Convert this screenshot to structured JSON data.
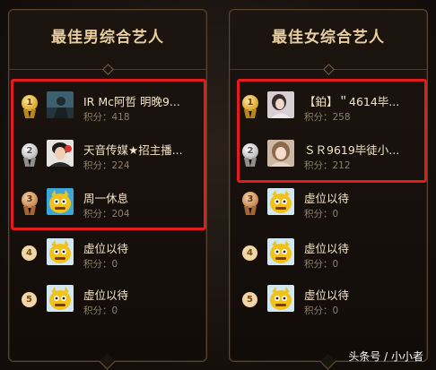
{
  "left_panel": {
    "title": "最佳男综合艺人",
    "entries": [
      {
        "rank": "1",
        "name": "IR Mc阿哲 明晚9...",
        "score": "积分：418"
      },
      {
        "rank": "2",
        "name": "天音传媒★招主播...",
        "score": "积分：224"
      },
      {
        "rank": "3",
        "name": "周一休息",
        "score": "积分：204"
      },
      {
        "rank": "4",
        "name": "虚位以待",
        "score": "积分：0"
      },
      {
        "rank": "5",
        "name": "虚位以待",
        "score": "积分：0"
      }
    ]
  },
  "right_panel": {
    "title": "最佳女综合艺人",
    "entries": [
      {
        "rank": "1",
        "name": "【鉑】＂4614毕...",
        "score": "积分：258"
      },
      {
        "rank": "2",
        "name": "ＳＲ9619毕徒小...",
        "score": "积分：212"
      },
      {
        "rank": "3",
        "name": "虚位以待",
        "score": "积分：0"
      },
      {
        "rank": "4",
        "name": "虚位以待",
        "score": "积分：0"
      },
      {
        "rank": "5",
        "name": "虚位以待",
        "score": "积分：0"
      }
    ]
  },
  "watermark": "头条号 / 小小者",
  "colors": {
    "background": "#1a1410",
    "title": "#e9cfa0",
    "name": "#f4e6c9",
    "score": "#8d7f6c",
    "highlight": "#e21b1b",
    "gold_medal": "#d9a227",
    "silver_medal": "#b9b9b9",
    "bronze_medal": "#c88752"
  },
  "icons": {
    "rank_1_2_3": "medal-icon",
    "rank_4_5": "rank-circle-icon",
    "placeholder_avatar": "yellow-mascot-avatar"
  }
}
